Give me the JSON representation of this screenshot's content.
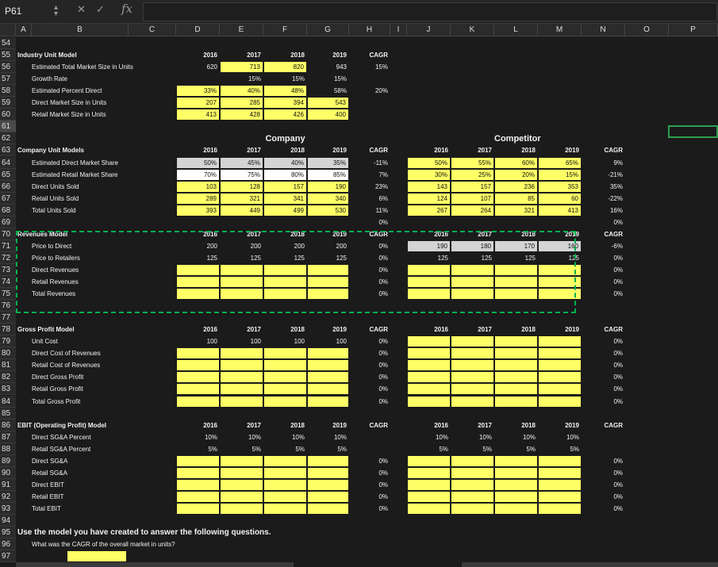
{
  "formula_bar": {
    "cell_ref": "P61",
    "fx": "fx",
    "formula": ""
  },
  "columns": [
    "A",
    "B",
    "C",
    "D",
    "E",
    "F",
    "G",
    "H",
    "I",
    "J",
    "K",
    "L",
    "M",
    "N",
    "O",
    "P"
  ],
  "rows": [
    "54",
    "55",
    "56",
    "57",
    "58",
    "59",
    "60",
    "61",
    "62",
    "63",
    "64",
    "65",
    "66",
    "67",
    "68",
    "69",
    "70",
    "71",
    "72",
    "73",
    "74",
    "75",
    "76",
    "77",
    "78",
    "79",
    "80",
    "81",
    "82",
    "83",
    "84",
    "85",
    "86",
    "87",
    "88",
    "89",
    "90",
    "91",
    "92",
    "93",
    "94",
    "95",
    "96",
    "97"
  ],
  "industry": {
    "title": "Industry Unit Model",
    "labels": [
      "Estimated Total Market Size in Units",
      "Growth Rate",
      "Estimated Percent Direct",
      "Direct Market Size in Units",
      "Retail Market Size in Units"
    ],
    "years": [
      "2016",
      "2017",
      "2018",
      "2019"
    ],
    "cagr_label": "CAGR",
    "total": [
      "620",
      "713",
      "820",
      "943"
    ],
    "total_cagr": "15%",
    "growth": [
      "",
      "15%",
      "15%",
      "15%"
    ],
    "pct_direct": [
      "33%",
      "40%",
      "48%",
      "58%"
    ],
    "pct_direct_cagr": "20%",
    "direct": [
      "207",
      "285",
      "394",
      "543"
    ],
    "retail": [
      "413",
      "428",
      "426",
      "400"
    ]
  },
  "company": {
    "title": "Company Unit Models",
    "company_header": "Company",
    "competitor_header": "Competitor",
    "labels": [
      "Estimated Direct Market Share",
      "Estimated Retail Market Share",
      "Direct Units Sold",
      "Retail Units Sold",
      "Total Units Sold"
    ],
    "co": [
      [
        "50%",
        "45%",
        "40%",
        "35%"
      ],
      [
        "70%",
        "75%",
        "80%",
        "85%"
      ],
      [
        "103",
        "128",
        "157",
        "190"
      ],
      [
        "289",
        "321",
        "341",
        "340"
      ],
      [
        "393",
        "449",
        "499",
        "530"
      ]
    ],
    "co_cagr": [
      "-11%",
      "7%",
      "23%",
      "6%",
      "11%"
    ],
    "comp": [
      [
        "50%",
        "55%",
        "60%",
        "65%"
      ],
      [
        "30%",
        "25%",
        "20%",
        "15%"
      ],
      [
        "143",
        "157",
        "236",
        "353"
      ],
      [
        "124",
        "107",
        "85",
        "60"
      ],
      [
        "267",
        "264",
        "321",
        "413"
      ]
    ],
    "comp_cagr": [
      "9%",
      "-21%",
      "35%",
      "-22%",
      "16%"
    ],
    "row69_cagr": "0%",
    "row69_comp": "0%"
  },
  "revenues": {
    "title": "Revenues Model",
    "labels": [
      "Price to Direct",
      "Price to Retailers",
      "Direct Revenues",
      "Retail Revenues",
      "Total Revenues"
    ],
    "co": [
      [
        "200",
        "200",
        "200",
        "200"
      ],
      [
        "125",
        "125",
        "125",
        "125"
      ]
    ],
    "comp": [
      [
        "190",
        "180",
        "170",
        "160"
      ],
      [
        "125",
        "125",
        "125",
        "125"
      ]
    ],
    "cagr": [
      "0%",
      "0%",
      "0%",
      "0%",
      "0%"
    ],
    "comp_cagr": [
      "-6%",
      "0%",
      "0%",
      "0%",
      "0%"
    ]
  },
  "gross": {
    "title": "Gross Profit Model",
    "labels": [
      "Unit Cost",
      "Direct Cost of Revenues",
      "Retail Cost of Revenues",
      "Direct Gross Profit",
      "Retail Gross Profit",
      "Total Gross Profit"
    ],
    "co_cost": [
      "100",
      "100",
      "100",
      "100"
    ],
    "cagr": [
      "0%",
      "0%",
      "0%",
      "0%",
      "0%",
      "0%"
    ],
    "comp_cagr": [
      "0%",
      "0%",
      "0%",
      "0%",
      "0%",
      "0%"
    ]
  },
  "ebit": {
    "title": "EBIT (Operating Profit) Model",
    "labels": [
      "Direct SG&A Percent",
      "Retail SG&A Percent",
      "Direct SG&A",
      "Retail SG&A",
      "Direct EBIT",
      "Retail EBIT",
      "Total EBIT"
    ],
    "co": [
      [
        "10%",
        "10%",
        "10%",
        "10%"
      ],
      [
        "5%",
        "5%",
        "5%",
        "5%"
      ]
    ],
    "comp": [
      [
        "10%",
        "10%",
        "10%",
        "10%"
      ],
      [
        "5%",
        "5%",
        "5%",
        "5%"
      ]
    ],
    "cagr": [
      "0%",
      "0%",
      "0%",
      "0%",
      "0%"
    ],
    "comp_cagr": [
      "0%",
      "0%",
      "0%",
      "0%",
      "0%"
    ]
  },
  "questions": {
    "title": "Use the model you have created to answer the following questions.",
    "q1": "What was the CAGR of the overall market in units?"
  }
}
